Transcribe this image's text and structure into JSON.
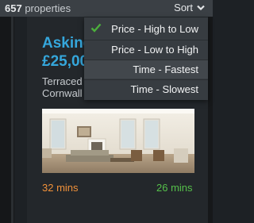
{
  "header": {
    "count": "657",
    "count_suffix": " properties",
    "sort_label": "Sort"
  },
  "sort_menu": {
    "items": [
      {
        "label": "Price - High to Low",
        "selected": true
      },
      {
        "label": "Price - Low to High",
        "selected": false
      },
      {
        "label": "Time - Fastest",
        "selected": false
      },
      {
        "label": "Time - Slowest",
        "selected": false
      }
    ]
  },
  "listing": {
    "asking_text": "Asking",
    "price_text": "£25,00",
    "address_line1": "Terraced",
    "address_line2": "Cornwall",
    "time_left": "32 mins",
    "time_right": "26 mins"
  },
  "colors": {
    "accent_blue": "#35a7dc",
    "time_orange": "#f0913a",
    "time_green": "#55c04a",
    "check_green": "#4caf3c",
    "menu_bg": "#373c41"
  }
}
